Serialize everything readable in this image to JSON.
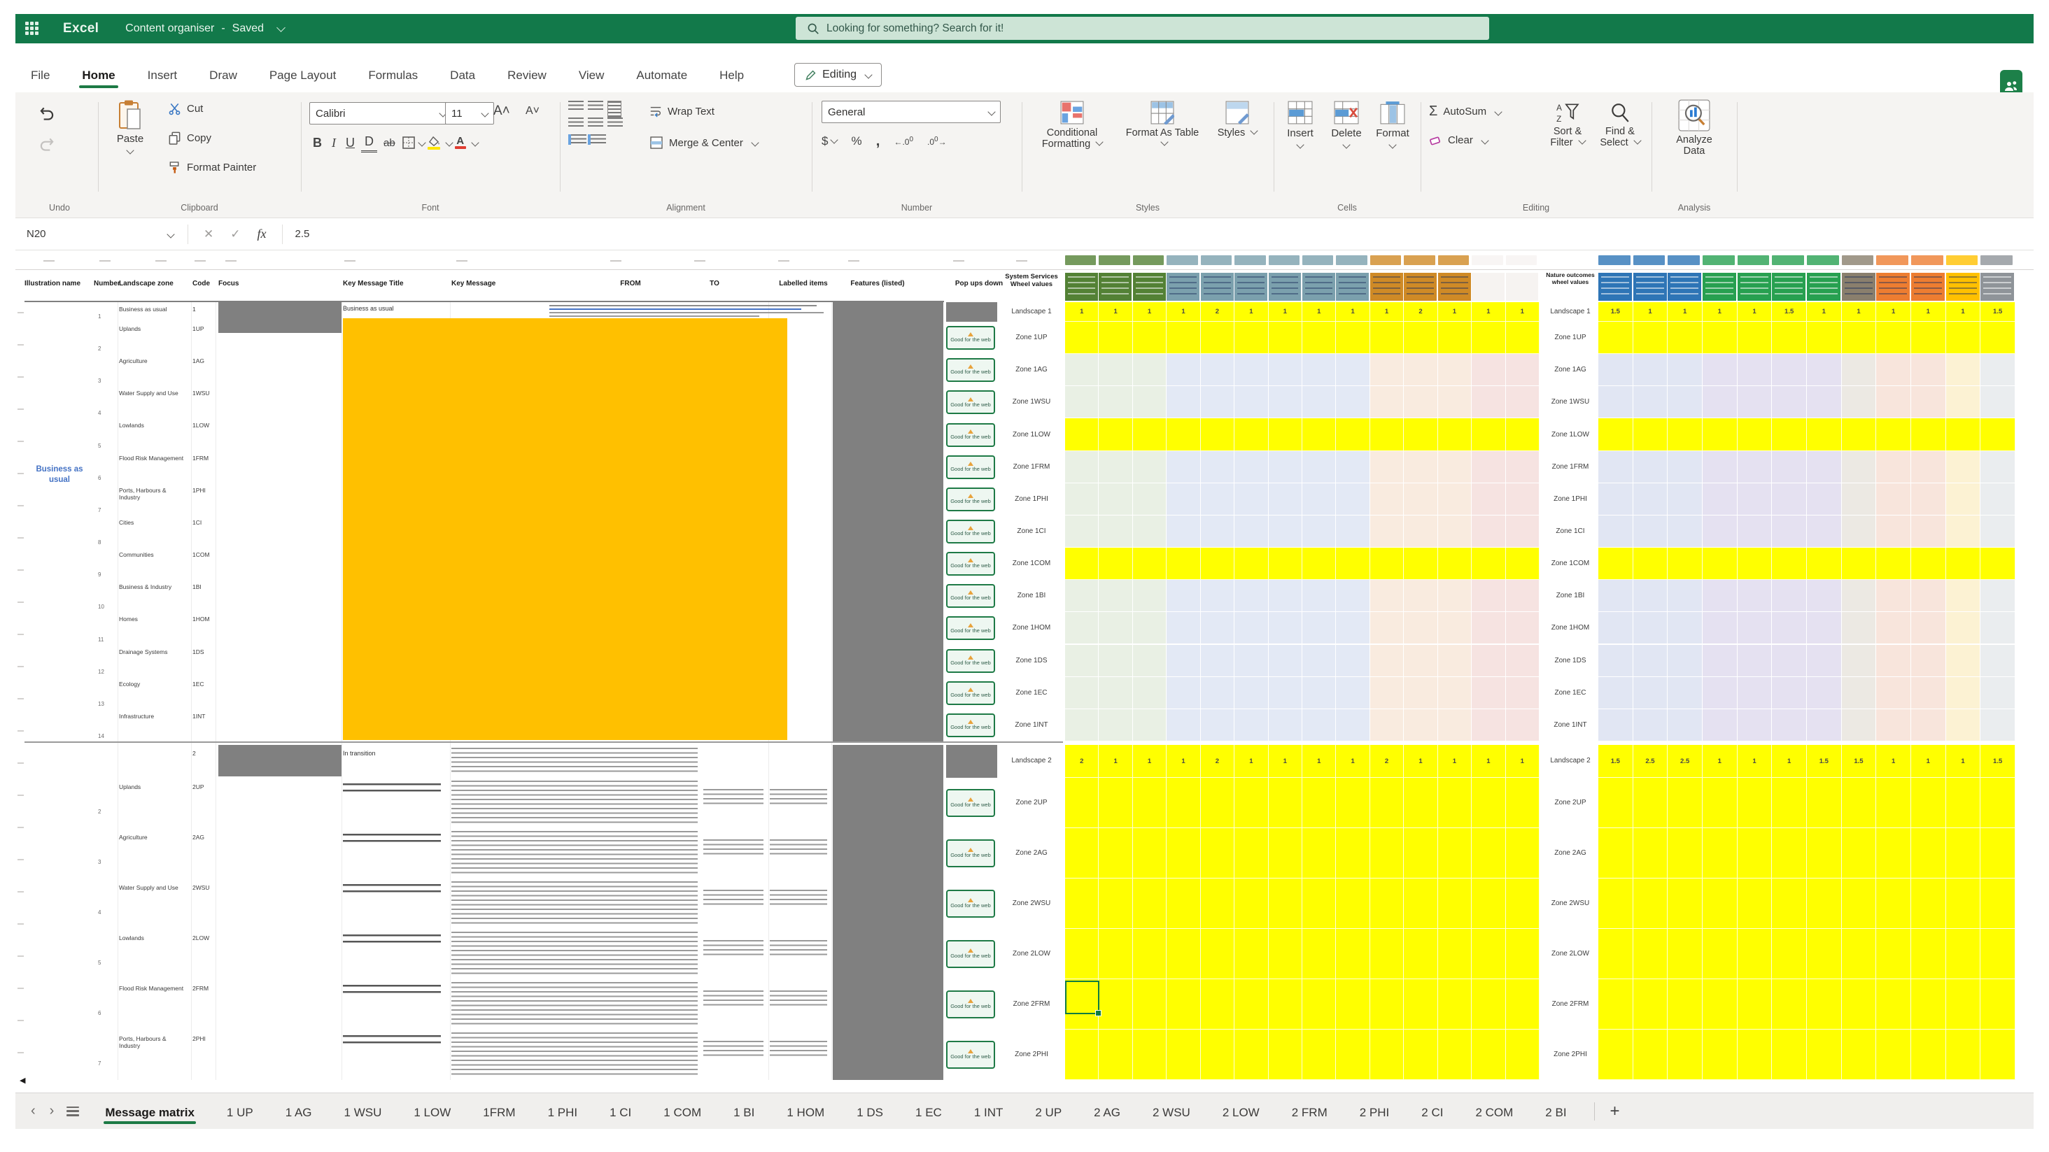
{
  "titlebar": {
    "app_name": "Excel",
    "doc_title": "Content organiser",
    "save_status": "Saved",
    "search_placeholder": "Looking for something? Search for it!"
  },
  "ribbon": {
    "tabs": [
      {
        "label": "File",
        "active": false
      },
      {
        "label": "Home",
        "active": true
      },
      {
        "label": "Insert",
        "active": false
      },
      {
        "label": "Draw",
        "active": false
      },
      {
        "label": "Page Layout",
        "active": false
      },
      {
        "label": "Formulas",
        "active": false
      },
      {
        "label": "Data",
        "active": false
      },
      {
        "label": "Review",
        "active": false
      },
      {
        "label": "View",
        "active": false
      },
      {
        "label": "Automate",
        "active": false
      },
      {
        "label": "Help",
        "active": false
      }
    ],
    "editing_mode": "Editing",
    "undo": {
      "label": "Undo"
    },
    "clipboard": {
      "label": "Clipboard",
      "paste": "Paste",
      "cut": "Cut",
      "copy": "Copy",
      "format_painter": "Format Painter"
    },
    "font": {
      "label": "Font",
      "font_name": "Calibri",
      "font_size": "11"
    },
    "alignment": {
      "label": "Alignment",
      "wrap_text": "Wrap Text",
      "merge_center": "Merge & Center"
    },
    "number": {
      "label": "Number",
      "format": "General"
    },
    "styles": {
      "label": "Styles",
      "conditional": "Conditional Formatting",
      "format_table": "Format As Table",
      "styles": "Styles"
    },
    "cells": {
      "label": "Cells",
      "insert": "Insert",
      "delete": "Delete",
      "format": "Format"
    },
    "editing": {
      "label": "Editing",
      "autosum": "AutoSum",
      "clear": "Clear",
      "sort_filter": "Sort & Filter",
      "find_select": "Find & Select"
    },
    "analysis": {
      "label": "Analysis",
      "analyze": "Analyze Data"
    }
  },
  "formula_bar": {
    "cell_ref": "N20",
    "value": "2.5"
  },
  "sheet": {
    "column_headers": [
      "Illustration name",
      "Number",
      "Landscape zone",
      "Code",
      "Focus",
      "Key Message Title",
      "Key Message",
      "FROM",
      "TO",
      "Labelled items",
      "Features (listed)",
      "Pop ups down"
    ],
    "services_wheel_header": "System Services Wheel values",
    "nature_wheel_header": "Nature outcomes wheel values",
    "illustration_label": "Business as usual",
    "popup_button_label": "Good for the web",
    "section1": {
      "landscape_label": "Landscape 1",
      "title_row1": "Business as usual",
      "rows": [
        {
          "num": 1,
          "name": "Business as usual",
          "code": "1"
        },
        {
          "num": 2,
          "name": "Uplands",
          "code": "1UP"
        },
        {
          "num": 3,
          "name": "Agriculture",
          "code": "1AG"
        },
        {
          "num": 4,
          "name": "Water Supply and Use",
          "code": "1WSU"
        },
        {
          "num": 5,
          "name": "Lowlands",
          "code": "1LOW"
        },
        {
          "num": 6,
          "name": "Flood Risk Management",
          "code": "1FRM"
        },
        {
          "num": 7,
          "name": "Ports, Harbours & Industry",
          "code": "1PHI"
        },
        {
          "num": 8,
          "name": "Cities",
          "code": "1CI"
        },
        {
          "num": 9,
          "name": "Communities",
          "code": "1COM"
        },
        {
          "num": 10,
          "name": "Business & Industry",
          "code": "1BI"
        },
        {
          "num": 11,
          "name": "Homes",
          "code": "1HOM"
        },
        {
          "num": 12,
          "name": "Drainage Systems",
          "code": "1DS"
        },
        {
          "num": 13,
          "name": "Ecology",
          "code": "1EC"
        },
        {
          "num": 14,
          "name": "Infrastructure",
          "code": "1INT"
        }
      ],
      "wheel_labels": [
        "Landscape 1",
        "Zone 1UP",
        "Zone 1AG",
        "Zone 1WSU",
        "Zone 1LOW",
        "Zone 1FRM",
        "Zone 1PHI",
        "Zone 1CI",
        "Zone 1COM",
        "Zone 1BI",
        "Zone 1HOM",
        "Zone 1DS",
        "Zone 1EC",
        "Zone 1INT"
      ],
      "matrix_a": {
        "styles": [
          "g",
          "g",
          "g",
          "t",
          "t",
          "t",
          "t",
          "t",
          "t",
          "o",
          "o",
          "o",
          "w",
          "w"
        ],
        "landscape_values": [
          "1",
          "1",
          "1",
          "1",
          "2",
          "1",
          "1",
          "1",
          "1",
          "1",
          "2",
          "1",
          "1",
          "1"
        ],
        "row_fills": [
          "Y",
          "P",
          "P",
          "Y",
          "P",
          "P",
          "P",
          "Y",
          "P",
          "P",
          "P",
          "P",
          "P"
        ]
      },
      "matrix_b": {
        "styles": [
          "b",
          "b",
          "b",
          "gr",
          "gr",
          "gr",
          "gr",
          "br",
          "or",
          "or",
          "am",
          "gy"
        ],
        "landscape_values": [
          "1.5",
          "1",
          "1",
          "1",
          "1",
          "1.5",
          "1",
          "1",
          "1",
          "1",
          "1",
          "1.5"
        ]
      }
    },
    "section2": {
      "landscape_label": "Landscape 2",
      "title_row1": "In transition",
      "code": "2",
      "rows": [
        {
          "num": 2,
          "name": "Uplands",
          "code": "2UP"
        },
        {
          "num": 3,
          "name": "Agriculture",
          "code": "2AG"
        },
        {
          "num": 4,
          "name": "Water Supply and Use",
          "code": "2WSU"
        },
        {
          "num": 5,
          "name": "Lowlands",
          "code": "2LOW"
        },
        {
          "num": 6,
          "name": "Flood Risk Management",
          "code": "2FRM"
        },
        {
          "num": 7,
          "name": "Ports, Harbours & Industry",
          "code": "2PHI"
        }
      ],
      "wheel_labels": [
        "Landscape 2",
        "Zone 2UP",
        "Zone 2AG",
        "Zone 2WSU",
        "Zone 2LOW",
        "Zone 2FRM",
        "Zone 2PHI"
      ],
      "matrix_a_values": [
        "2",
        "1",
        "1",
        "1",
        "2",
        "1",
        "1",
        "1",
        "1",
        "2",
        "1",
        "1",
        "1",
        "1"
      ],
      "matrix_b_values": [
        "1.5",
        "2.5",
        "2.5",
        "1",
        "1",
        "1",
        "1.5",
        "1.5",
        "1",
        "1",
        "1",
        "1.5"
      ]
    }
  },
  "sheet_tabs": {
    "active": "Message matrix",
    "tabs": [
      "Message matrix",
      "1 UP",
      "1 AG",
      "1 WSU",
      "1 LOW",
      "1FRM",
      "1 PHI",
      "1 CI",
      "1 COM",
      "1 BI",
      "1 HOM",
      "1 DS",
      "1 EC",
      "1 INT",
      "2 UP",
      "2 AG",
      "2 WSU",
      "2 LOW",
      "2 FRM",
      "2 PHI",
      "2 CI",
      "2 COM",
      "2 BI"
    ],
    "new_sheet": "+"
  }
}
